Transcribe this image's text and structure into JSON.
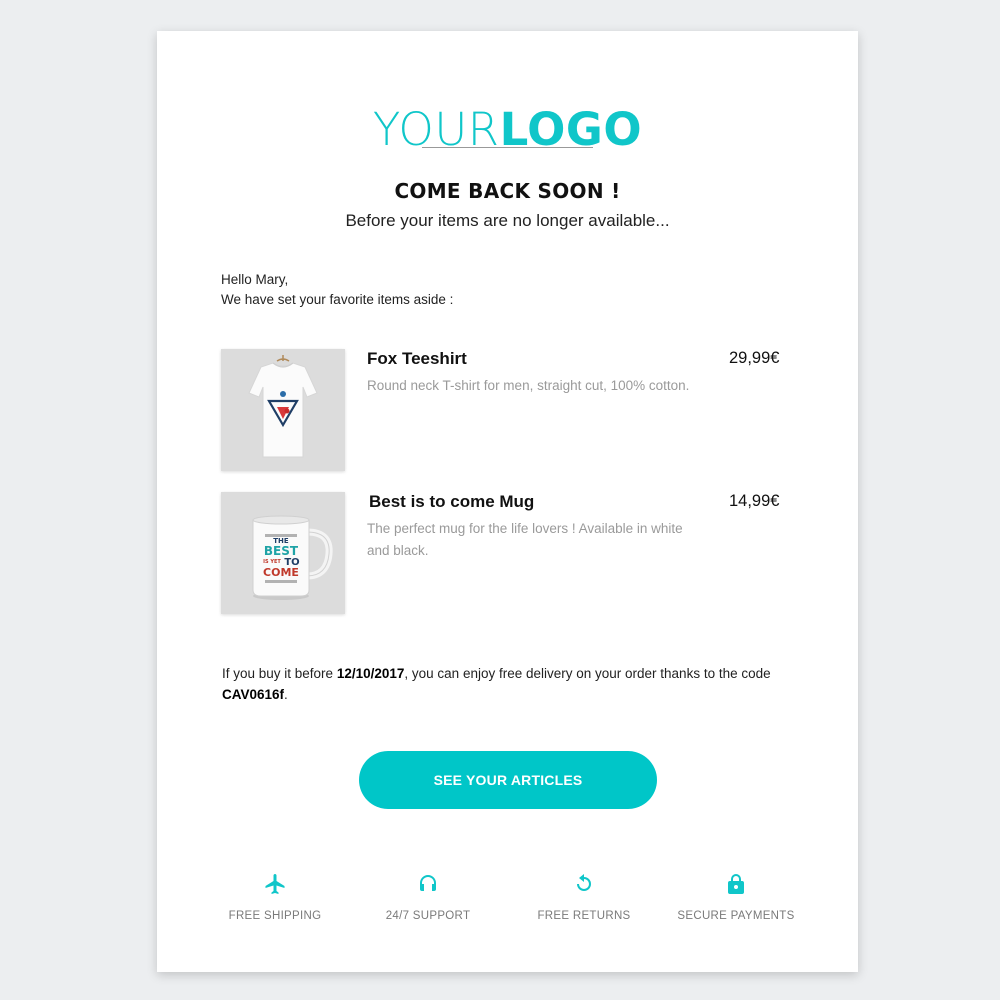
{
  "logo": {
    "part1": "YOUR",
    "part2": "LOGO"
  },
  "headline": "COME BACK SOON !",
  "subheadline": "Before your items are no longer available...",
  "greeting": {
    "line1": "Hello Mary,",
    "line2": "We have set your favorite items aside :"
  },
  "products": [
    {
      "name": "Fox Teeshirt",
      "description": "Round neck T-shirt for men, straight cut, 100% cotton.",
      "price": "29,99€",
      "image_icon": "tshirt-icon"
    },
    {
      "name": "Best is to come Mug",
      "description": "The perfect mug for the life lovers ! Available in white and black.",
      "price": "14,99€",
      "image_icon": "mug-icon"
    }
  ],
  "mug_print": {
    "line1": "THE",
    "line2": "BEST",
    "line3": "IS YET",
    "line4": "TO",
    "line5": "COME"
  },
  "offer": {
    "text1": "If you buy it before ",
    "date": "12/10/2017",
    "text2": ", you can enjoy free delivery on your order thanks to the code ",
    "code": "CAV0616f",
    "text3": "."
  },
  "cta_label": "SEE YOUR ARTICLES",
  "features": [
    {
      "label": "FREE SHIPPING",
      "icon": "airplane-icon"
    },
    {
      "label": "24/7 SUPPORT",
      "icon": "headset-icon"
    },
    {
      "label": "FREE RETURNS",
      "icon": "return-arrow-icon"
    },
    {
      "label": "SECURE PAYMENTS",
      "icon": "lock-icon"
    }
  ],
  "colors": {
    "accent": "#00c6c8",
    "background": "#eceef0"
  }
}
